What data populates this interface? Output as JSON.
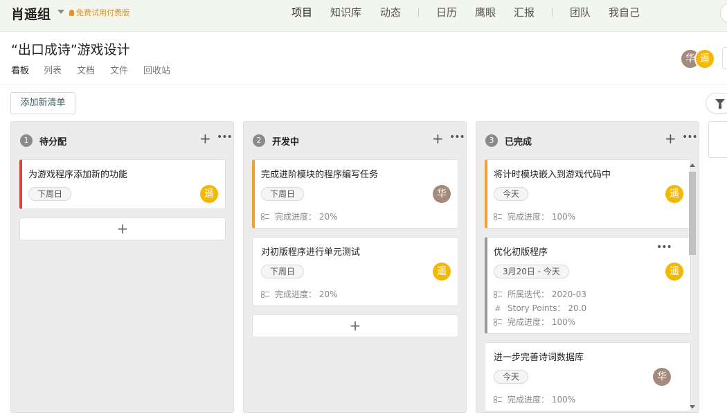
{
  "topbar": {
    "team_name": "肖遥组",
    "trial": "免费试用付费版",
    "nav": [
      "项目",
      "知识库",
      "动态",
      "日历",
      "鹰眼",
      "汇报",
      "团队",
      "我自己"
    ]
  },
  "project": {
    "title": "“出口成诗”游戏设计",
    "tabs": [
      "看板",
      "列表",
      "文档",
      "文件",
      "回收站"
    ],
    "members": [
      "华",
      "遥"
    ]
  },
  "toolbar": {
    "add_list": "添加新清单"
  },
  "progress_label": "完成进度：",
  "columns": [
    {
      "num": "1",
      "title": "待分配",
      "cards": [
        {
          "title": "为游戏程序添加新的功能",
          "date": "下周日",
          "avatar": "遥"
        }
      ]
    },
    {
      "num": "2",
      "title": "开发中",
      "cards": [
        {
          "title": "完成进阶模块的程序编写任务",
          "date": "下周日",
          "avatar": "华",
          "progress": "20%"
        },
        {
          "title": "对初版程序进行单元测试",
          "date": "下周日",
          "avatar": "遥",
          "progress": "20%"
        }
      ]
    },
    {
      "num": "3",
      "title": "已完成",
      "cards": [
        {
          "title": "将计时模块嵌入到游戏代码中",
          "date": "今天",
          "avatar": "遥",
          "progress": "100%"
        },
        {
          "title": "优化初版程序",
          "date": "3月20日 - 今天",
          "avatar": "遥",
          "iteration_label": "所属迭代：",
          "iteration": "2020-03",
          "story_points_label": "Story Points：",
          "story_points": "20.0",
          "progress": "100%"
        },
        {
          "title": "进一步完善诗词数据库",
          "date": "今天",
          "avatar": "华",
          "progress": "100%"
        }
      ]
    }
  ],
  "colors": {
    "topbar_bg": "#f3f6ec",
    "red": "#d9443a",
    "orange": "#f0a030",
    "avatar_hua": "#a38a7c",
    "avatar_yao": "#f5b800"
  },
  "icons": {
    "add": "plus-icon",
    "more": "more-icon",
    "filter": "filter-icon",
    "progress": "subtask-icon",
    "story": "hash-icon"
  }
}
